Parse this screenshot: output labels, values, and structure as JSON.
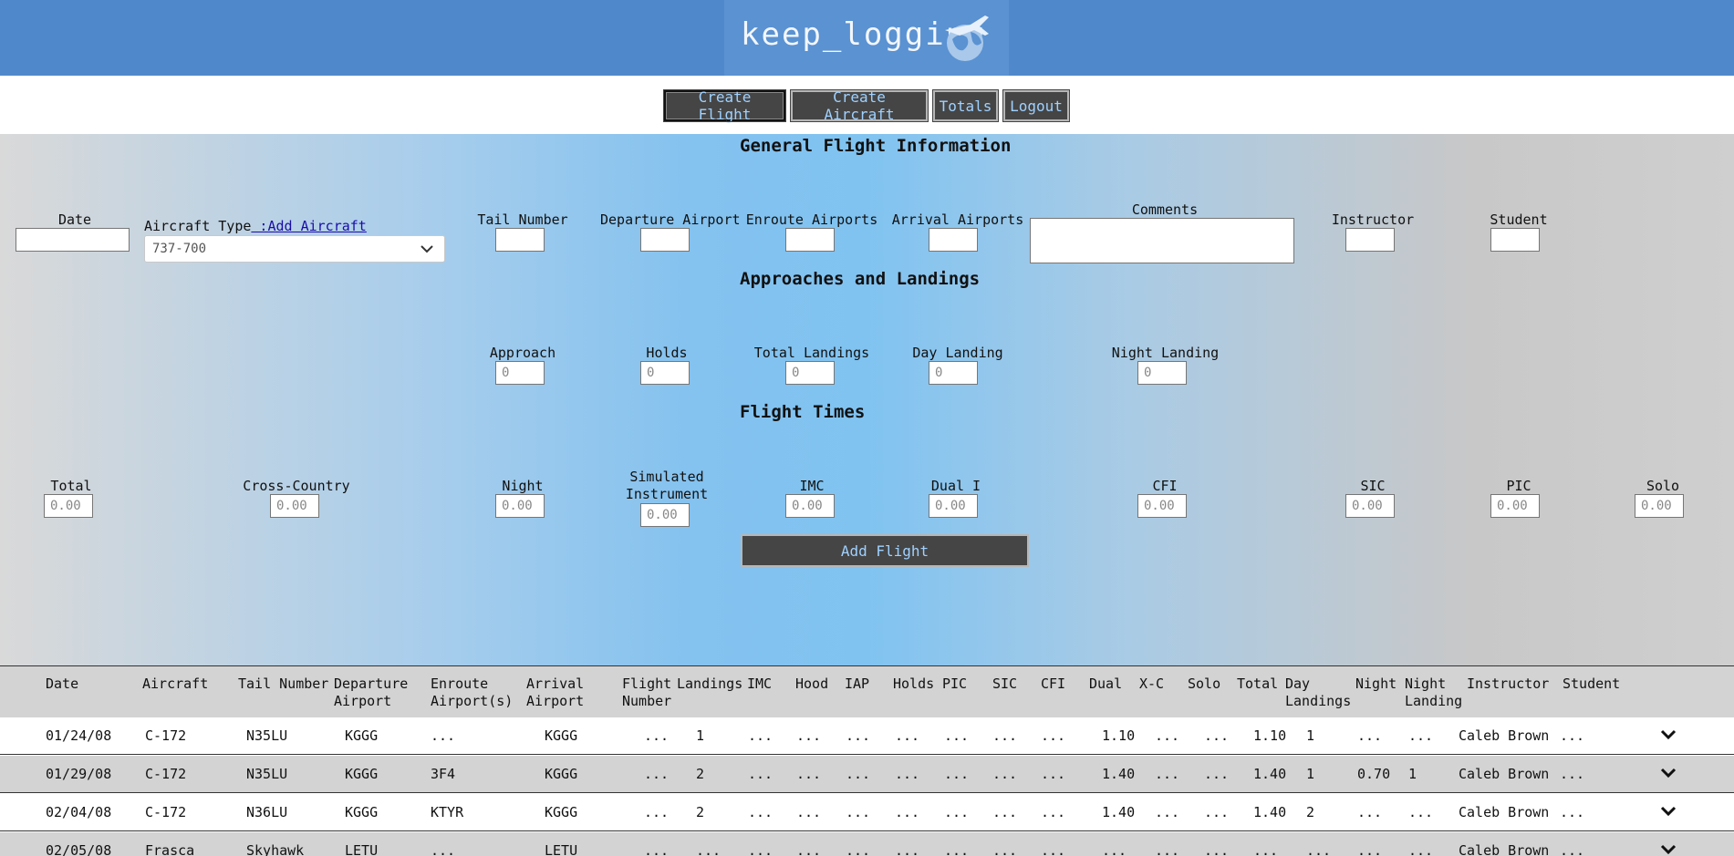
{
  "app": {
    "logo_text": "keep_logging",
    "logo_icon": "globe-airplane-icon"
  },
  "nav": {
    "create_flight": "Create Flight",
    "create_aircraft": "Create Aircraft",
    "totals": "Totals",
    "logout": "Logout"
  },
  "general": {
    "title": "General Flight Information",
    "date_label": "Date",
    "aircraft_type_label": "Aircraft Type",
    "add_aircraft_link": " :Add Aircraft",
    "aircraft_type_value": "737-700",
    "tail_number_label": "Tail Number",
    "departure_label": "Departure Airport",
    "enroute_label": "Enroute Airports",
    "arrival_label": "Arrival Airports",
    "comments_label": "Comments",
    "instructor_label": "Instructor",
    "student_label": "Student"
  },
  "landings": {
    "title": "Approaches and Landings",
    "approach_label": "Approach",
    "holds_label": "Holds",
    "total_landings_label": "Total Landings",
    "day_landing_label": "Day Landing",
    "night_landing_label": "Night Landing",
    "placeholder": "0"
  },
  "times": {
    "title": "Flight Times",
    "total_label": "Total",
    "cross_country_label": "Cross-Country",
    "night_label": "Night",
    "sim_label": "Simulated Instrument",
    "imc_label": "IMC",
    "dual_label": "Dual I",
    "cfi_label": "CFI",
    "sic_label": "SIC",
    "pic_label": "PIC",
    "solo_label": "Solo",
    "placeholder": "0.00"
  },
  "add_flight": "Add Flight",
  "table": {
    "headers": [
      "Date",
      "Aircraft",
      "Tail Number",
      "Departure Airport",
      "Enroute Airport(s)",
      "Arrival Airport",
      "Flight Number",
      "Landings",
      "IMC",
      "Hood",
      "IAP",
      "Holds",
      "PIC",
      "SIC",
      "CFI",
      "Dual",
      "X-C",
      "Solo",
      "Total",
      "Day Landings",
      "Night",
      "Night Landing",
      "Instructor",
      "Student"
    ],
    "rows": [
      [
        "01/24/08",
        "C-172",
        "N35LU",
        "KGGG",
        "...",
        "KGGG",
        "...",
        "1",
        "...",
        "...",
        "...",
        "...",
        "...",
        "...",
        "...",
        "1.10",
        "...",
        "...",
        "1.10",
        "1",
        "...",
        "...",
        "Caleb Brown",
        "..."
      ],
      [
        "01/29/08",
        "C-172",
        "N35LU",
        "KGGG",
        "3F4",
        "KGGG",
        "...",
        "2",
        "...",
        "...",
        "...",
        "...",
        "...",
        "...",
        "...",
        "1.40",
        "...",
        "...",
        "1.40",
        "1",
        "0.70",
        "1",
        "Caleb Brown",
        "..."
      ],
      [
        "02/04/08",
        "C-172",
        "N36LU",
        "KGGG",
        "KTYR",
        "KGGG",
        "...",
        "2",
        "...",
        "...",
        "...",
        "...",
        "...",
        "...",
        "...",
        "1.40",
        "...",
        "...",
        "1.40",
        "2",
        "...",
        "...",
        "Caleb Brown",
        "..."
      ],
      [
        "02/05/08",
        "Frasca",
        "Skyhawk",
        "LETU",
        "...",
        "LETU",
        "...",
        "...",
        "...",
        "...",
        "...",
        "...",
        "...",
        "...",
        "...",
        "...",
        "...",
        "...",
        "...",
        "...",
        "...",
        "...",
        "Caleb Brown",
        "..."
      ]
    ]
  },
  "colors": {
    "header": "#5089cb",
    "button_bg": "#454545",
    "button_text": "#9fd1ff"
  }
}
